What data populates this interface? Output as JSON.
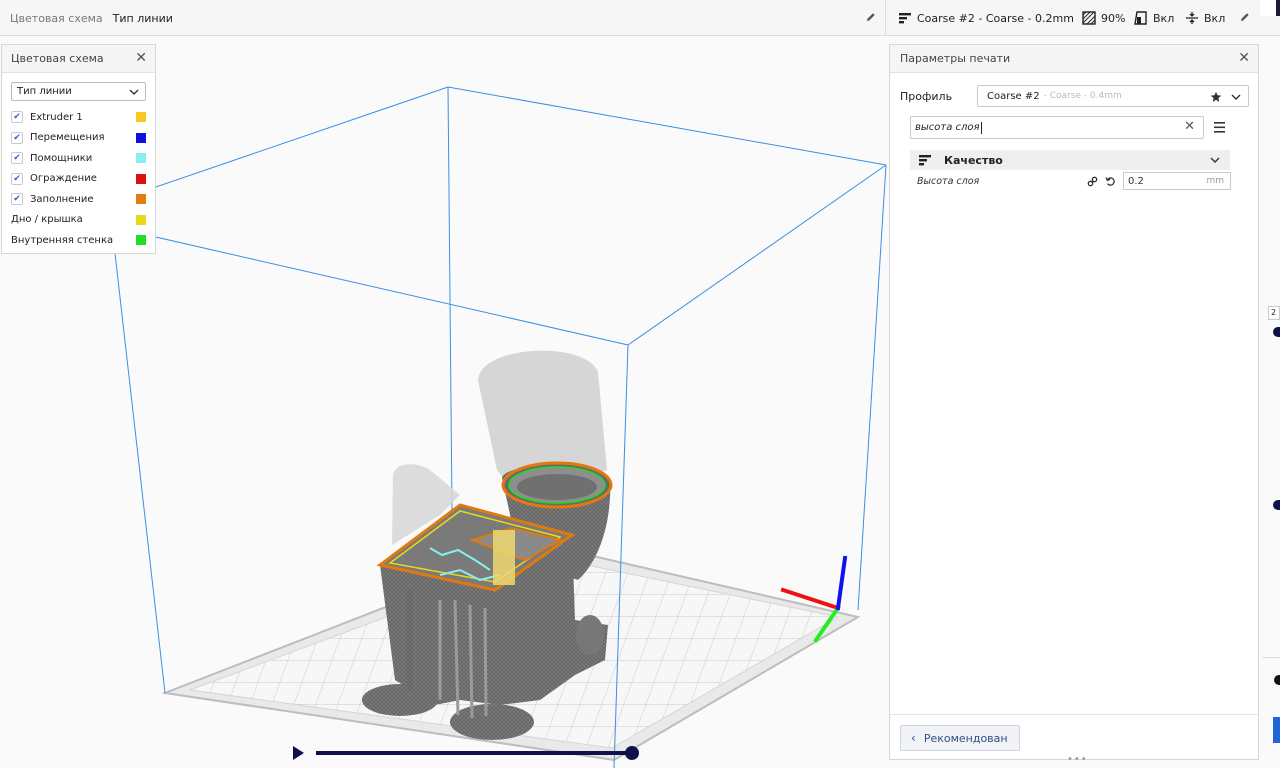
{
  "header": {
    "crumb_scheme": "Цветовая схема",
    "crumb_linetype": "Тип линии",
    "profile_summary": "Coarse #2 - Coarse - 0.2mm",
    "infill_value": "90%",
    "support_value": "Вкл",
    "adhesion_value": "Вкл"
  },
  "color_scheme_panel": {
    "title": "Цветовая схема",
    "select_value": "Тип линии",
    "items": [
      {
        "label": "Extruder 1",
        "checked": true,
        "color": "#f8c822"
      },
      {
        "label": "Перемещения",
        "checked": true,
        "color": "#1111dd"
      },
      {
        "label": "Помощники",
        "checked": true,
        "color": "#88eeee"
      },
      {
        "label": "Ограждение",
        "checked": true,
        "color": "#dd1111"
      },
      {
        "label": "Заполнение",
        "checked": true,
        "color": "#e57c10"
      },
      {
        "label": "Дно / крышка",
        "checked": false,
        "color": "#e9d91a"
      },
      {
        "label": "Внутренняя стенка",
        "checked": false,
        "color": "#22dd22"
      }
    ]
  },
  "print_settings": {
    "title": "Параметры печати",
    "profile_label": "Профиль",
    "profile_name": "Coarse #2",
    "profile_sub": "- Coarse - 0.4mm",
    "search_value": "высота слоя",
    "category": "Качество",
    "setting_label": "Высота слоя",
    "setting_value": "0.2",
    "setting_unit": "mm",
    "recommended_button": "Рекомендован"
  },
  "layer_slider_label": "2"
}
